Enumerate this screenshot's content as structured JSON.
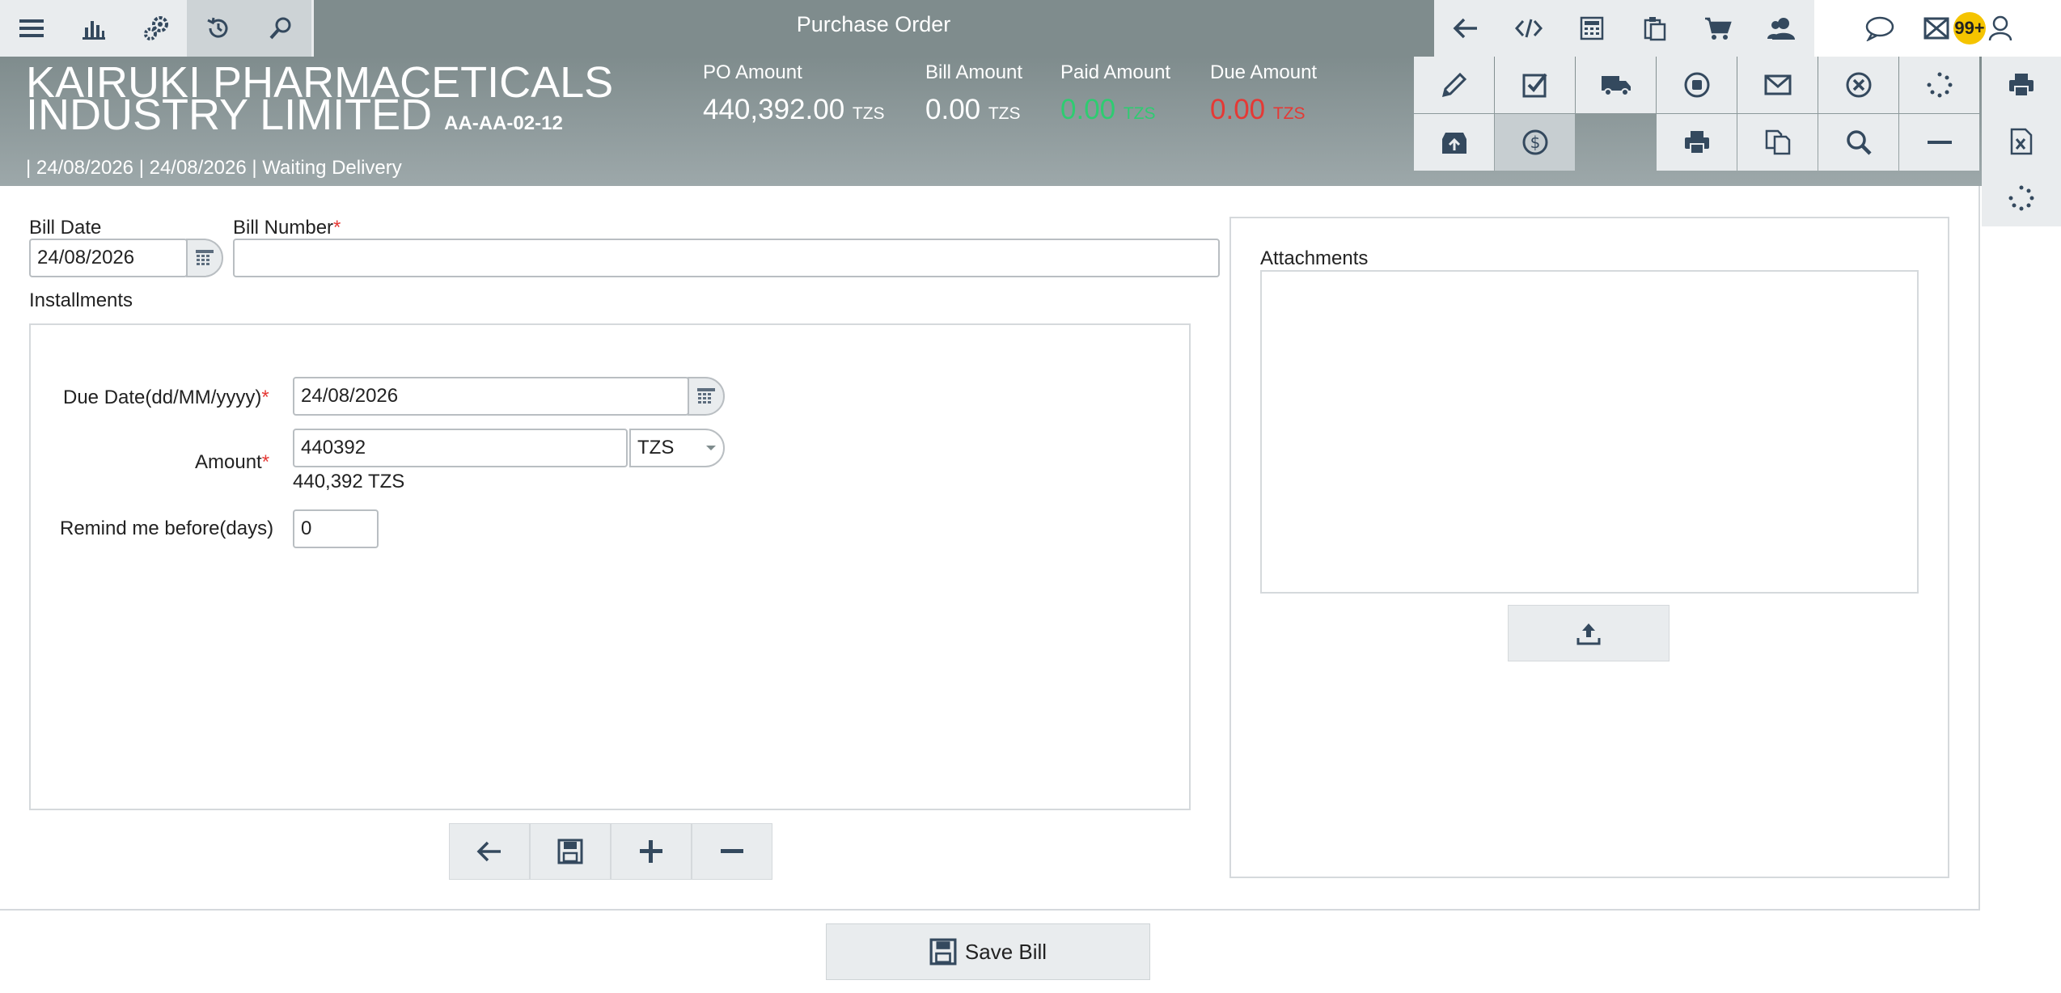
{
  "topbar": {
    "title": "Purchase Order",
    "left_icons": [
      "menu-icon",
      "bar-chart-icon",
      "gears-icon",
      "history-icon",
      "search-icon"
    ],
    "right_icons": [
      "arrow-left-icon",
      "code-icon",
      "calculator-icon",
      "clipboard-icon",
      "cart-icon",
      "user-group-icon"
    ],
    "badge": "99+"
  },
  "header": {
    "company_line1": "KAIRUKI PHARMACETICALS",
    "company_line2": "INDUSTRY LIMITED",
    "code": "AA-AA-02-12",
    "status_line": "| 24/08/2026 | 24/08/2026 | Waiting Delivery",
    "metrics": [
      {
        "label": "PO Amount",
        "value": "440,392.00",
        "currency": "TZS",
        "color": "#ffffff"
      },
      {
        "label": "Bill Amount",
        "value": "0.00",
        "currency": "TZS",
        "color": "#ffffff"
      },
      {
        "label": "Paid Amount",
        "value": "0.00",
        "currency": "TZS",
        "color": "#2ecc71"
      },
      {
        "label": "Due Amount",
        "value": "0.00",
        "currency": "TZS",
        "color": "#e53935"
      }
    ]
  },
  "form": {
    "bill_date_label": "Bill Date",
    "bill_date_value": "24/08/2026",
    "bill_number_label": "Bill Number",
    "bill_number_value": "",
    "required_mark": "*",
    "installments_label": "Installments",
    "due_date_label": "Due Date(dd/MM/yyyy)",
    "due_date_value": "24/08/2026",
    "amount_label": "Amount",
    "amount_value": "440392",
    "currency_selected": "TZS",
    "amount_formatted": "440,392 TZS",
    "remind_label": "Remind me before(days)",
    "remind_value": "0",
    "attachments_label": "Attachments"
  },
  "footer": {
    "save_bill_label": "Save Bill"
  },
  "colors": {
    "bar": "#7f8c8d",
    "button_bg": "#e9ecee",
    "badge": "#f5c400",
    "paid": "#2ecc71",
    "due": "#e53935"
  }
}
